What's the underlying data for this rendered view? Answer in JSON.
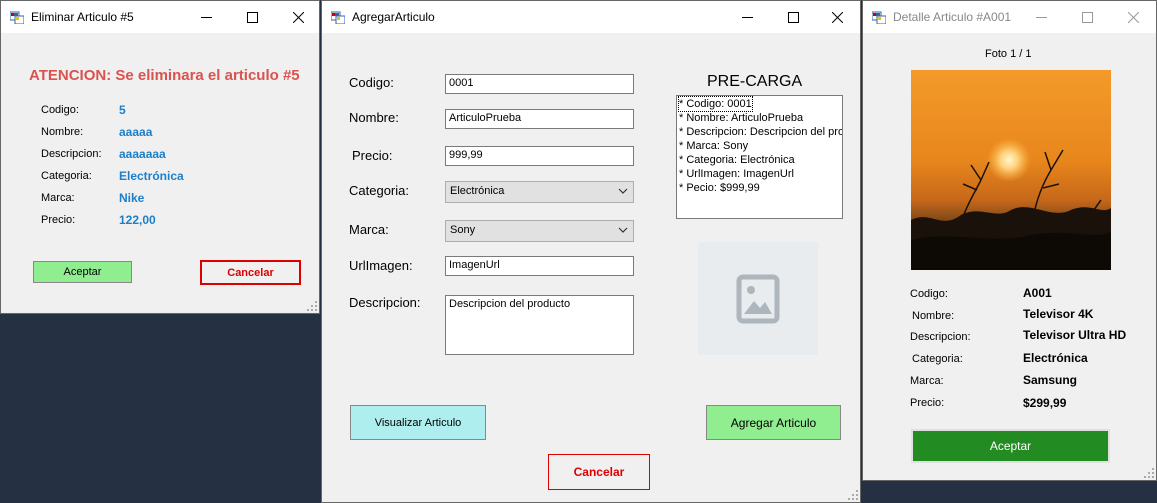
{
  "colors": {
    "desktop_bg": "#253142",
    "warning_red": "#d9534f",
    "value_blue": "#1b7fc9",
    "accept_green": "#90ee90",
    "visualize_cyan": "#afeeee",
    "accept_dark_green": "#228b22",
    "cancel_red": "#dd0000"
  },
  "delete_window": {
    "title": "Eliminar Articulo #5",
    "warning": "ATENCION: Se eliminara el articulo #5",
    "fields": [
      {
        "label": "Codigo:",
        "value": "5"
      },
      {
        "label": "Nombre:",
        "value": "aaaaa"
      },
      {
        "label": "Descripcion:",
        "value": "aaaaaaa"
      },
      {
        "label": "Categoria:",
        "value": "Electrónica"
      },
      {
        "label": "Marca:",
        "value": "Nike"
      },
      {
        "label": "Precio:",
        "value": "122,00"
      }
    ],
    "accept_label": "Aceptar",
    "cancel_label": "Cancelar"
  },
  "add_window": {
    "title": "AgregarArticulo",
    "labels": {
      "codigo": "Codigo:",
      "nombre": "Nombre:",
      "precio": "Precio:",
      "categoria": "Categoria:",
      "marca": "Marca:",
      "urlimagen": "UrlImagen:",
      "descripcion": "Descripcion:"
    },
    "values": {
      "codigo": "0001",
      "nombre": "ArticuloPrueba",
      "precio": "999,99",
      "categoria": "Electrónica",
      "marca": "Sony",
      "urlimagen": "ImagenUrl",
      "descripcion": "Descripcion del producto"
    },
    "precarga_title": "PRE-CARGA",
    "precarga_lines": [
      "* Codigo: 0001",
      "* Nombre: ArticuloPrueba",
      "* Descripcion: Descripcion del producto",
      "* Marca: Sony",
      "* Categoria: Electrónica",
      "* UrlImagen: ImagenUrl",
      "* Pecio: $999,99"
    ],
    "image_placeholder_icon": "image-placeholder-icon",
    "visualize_label": "Visualizar Articulo",
    "add_label": "Agregar Articulo",
    "cancel_label": "Cancelar"
  },
  "detail_window": {
    "title": "Detalle Articulo #A001",
    "photo_counter": "Foto 1 / 1",
    "fields": [
      {
        "label": "Codigo:",
        "value": "A001"
      },
      {
        "label": "Nombre:",
        "value": "Televisor 4K"
      },
      {
        "label": "Descripcion:",
        "value": "Televisor Ultra HD"
      },
      {
        "label": "Categoria:",
        "value": "Electrónica"
      },
      {
        "label": "Marca:",
        "value": "Samsung"
      },
      {
        "label": "Precio:",
        "value": "$299,99"
      }
    ],
    "accept_label": "Aceptar"
  }
}
